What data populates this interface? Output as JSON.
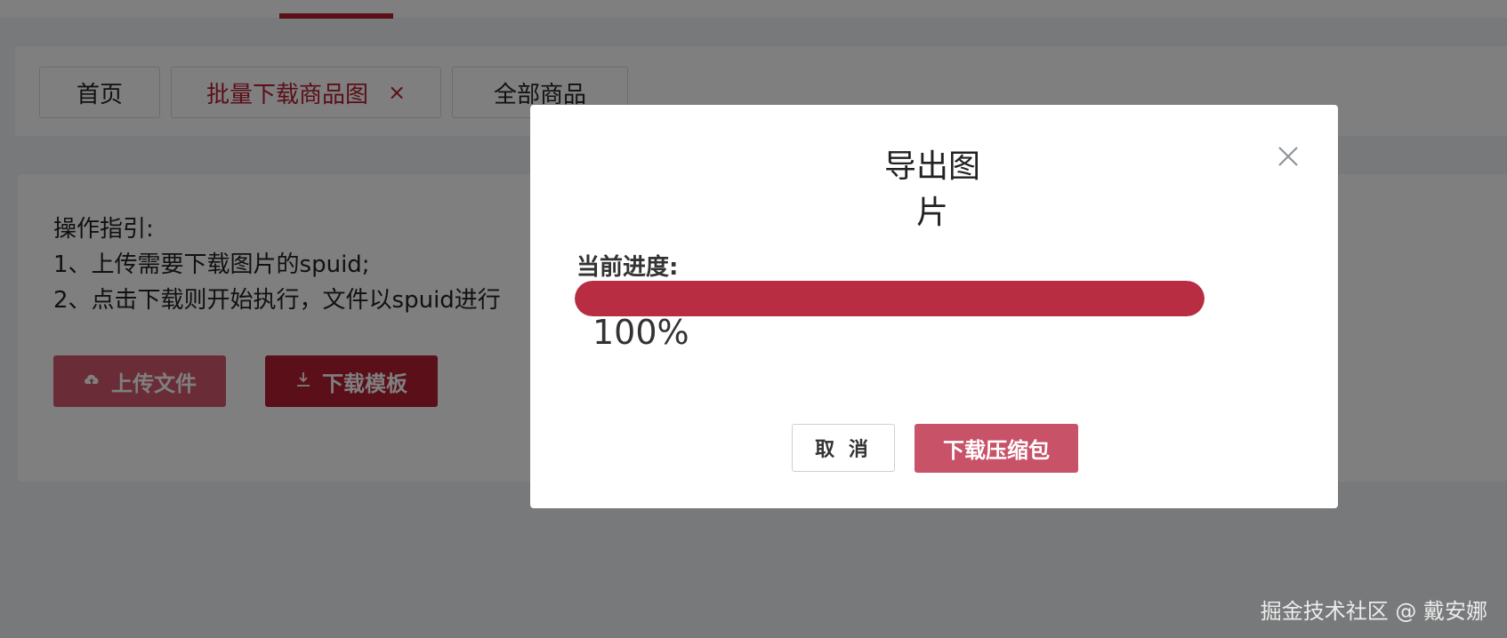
{
  "tabs": [
    {
      "label": "首页",
      "active": false
    },
    {
      "label": "批量下载商品图",
      "active": true,
      "close_icon": "×"
    },
    {
      "label": "全部商品",
      "active": false
    }
  ],
  "guide": {
    "title": "操作指引:",
    "line1": "1、上传需要下载图片的spuid;",
    "line2": "2、点击下载则开始执行，文件以spuid进行"
  },
  "buttons": {
    "upload": "上传文件",
    "download_template": "下载模板"
  },
  "dialog": {
    "title": "导出图片",
    "progress_label": "当前进度:",
    "progress_text": "100%",
    "progress_value": 1.0,
    "cancel": "取 消",
    "download_zip": "下载压缩包"
  },
  "watermark": "掘金技术社区 @ 戴安娜",
  "colors": {
    "accent": "#b41f33",
    "progress": "#b82d42",
    "primary_button": "#c85268"
  },
  "icons": {
    "upload": "cloud-upload-icon",
    "download": "download-icon",
    "close": "close-icon"
  }
}
